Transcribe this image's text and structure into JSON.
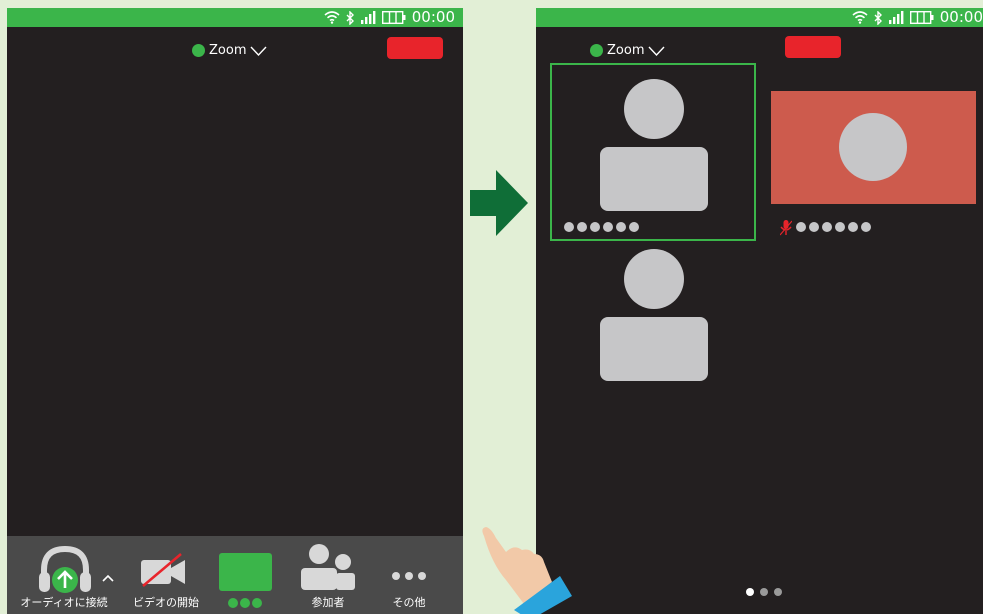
{
  "status": {
    "time": "00:00"
  },
  "meeting": {
    "app_name": "Zoom"
  },
  "toolbar": {
    "audio_label": "オーディオに接続",
    "video_label": "ビデオの開始",
    "participants_label": "参加者",
    "more_label": "その他"
  },
  "colors": {
    "accent_green": "#3bb54a",
    "end_red": "#e8242b",
    "active_speaker_bg": "#cd5b4d",
    "arrow_green": "#0f6e37"
  },
  "gallery": {
    "page_count": 3,
    "current_page": 1
  }
}
